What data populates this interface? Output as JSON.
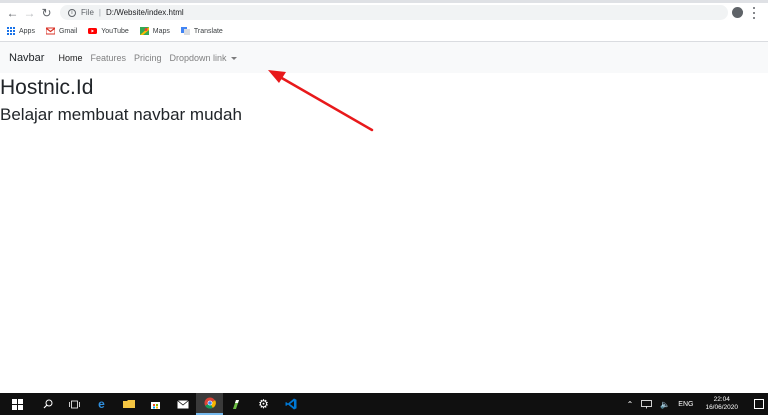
{
  "browser": {
    "url_scheme": "File",
    "url": "D:/Website/index.html",
    "bookmarks": [
      {
        "label": "Apps",
        "icon": "apps-grid-icon"
      },
      {
        "label": "Gmail",
        "icon": "gmail-icon",
        "color": "#d93025"
      },
      {
        "label": "YouTube",
        "icon": "youtube-icon",
        "color": "#ff0000"
      },
      {
        "label": "Maps",
        "icon": "maps-icon",
        "color": "#34a853"
      },
      {
        "label": "Translate",
        "icon": "translate-icon",
        "color": "#4285f4"
      }
    ]
  },
  "navbar": {
    "brand": "Navbar",
    "links": [
      "Home",
      "Features",
      "Pricing",
      "Dropdown link"
    ]
  },
  "content": {
    "heading": "Hostnic.Id",
    "subheading": "Belajar membuat navbar mudah"
  },
  "annotation": {
    "arrow_color": "#e8191b"
  },
  "taskbar": {
    "language": "ENG",
    "time": "22:04",
    "date": "16/06/2020"
  }
}
